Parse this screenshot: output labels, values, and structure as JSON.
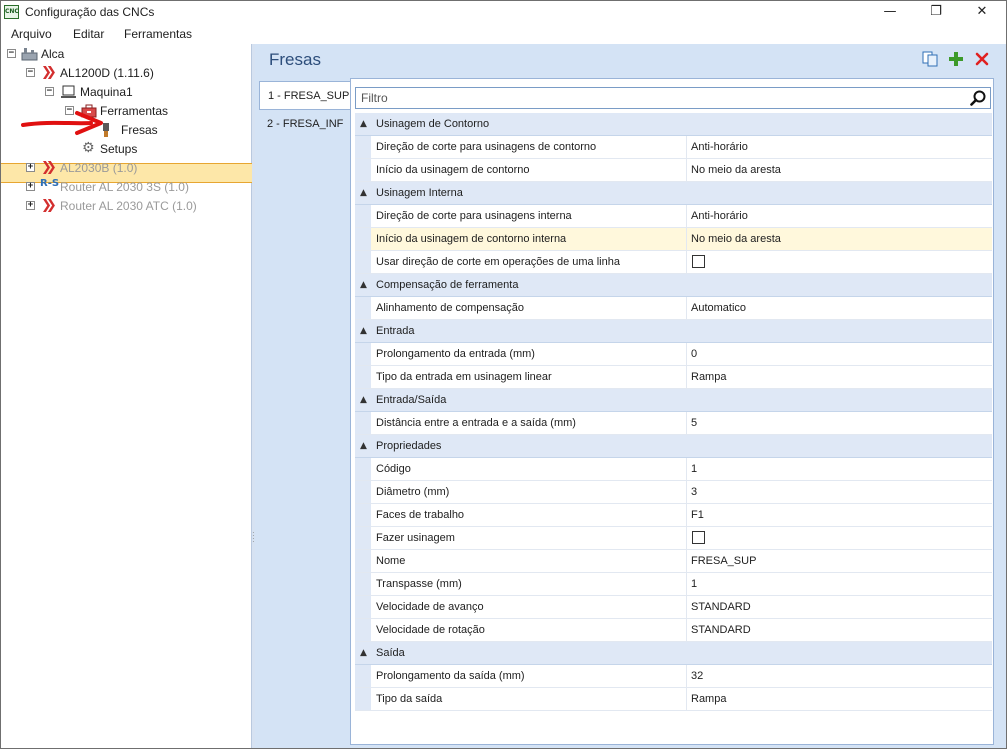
{
  "window": {
    "title": "Configuração das CNCs",
    "app_icon_text": "CNC"
  },
  "menu": [
    "Arquivo",
    "Editar",
    "Ferramentas"
  ],
  "tree": {
    "root": "Alca",
    "machine1": "AL1200D (1.11.6)",
    "maquina": "Maquina1",
    "ferramentas": "Ferramentas",
    "fresas": "Fresas",
    "setups": "Setups",
    "machine2": "AL2030B (1.0)",
    "machine3": "Router AL 2030 3S (1.0)",
    "machine3_badge": "R-S",
    "machine4": "Router AL 2030 ATC (1.0)"
  },
  "panel": {
    "title": "Fresas",
    "tabs": [
      "1 - FRESA_SUP",
      "2 - FRESA_INF"
    ],
    "active_tab": 0,
    "filter_placeholder": "Filtro"
  },
  "properties": [
    {
      "category": "Usinagem de Contorno",
      "items": [
        {
          "name": "Direção de corte para usinagens de contorno",
          "value": "Anti-horário"
        },
        {
          "name": "Início da usinagem de contorno",
          "value": "No meio da aresta"
        }
      ]
    },
    {
      "category": "Usinagem Interna",
      "items": [
        {
          "name": "Direção de corte para usinagens interna",
          "value": "Anti-horário"
        },
        {
          "name": "Início da usinagem de contorno interna",
          "value": "No meio da aresta",
          "highlight": true
        },
        {
          "name": "Usar direção de corte em operações de uma linha",
          "checkbox": false
        }
      ]
    },
    {
      "category": "Compensação de ferramenta",
      "items": [
        {
          "name": "Alinhamento de compensação",
          "value": "Automatico"
        }
      ]
    },
    {
      "category": "Entrada",
      "items": [
        {
          "name": "Prolongamento da entrada (mm)",
          "value": "0"
        },
        {
          "name": "Tipo da entrada em usinagem linear",
          "value": "Rampa"
        }
      ]
    },
    {
      "category": "Entrada/Saída",
      "items": [
        {
          "name": "Distância entre a entrada e a saída (mm)",
          "value": "5"
        }
      ]
    },
    {
      "category": "Propriedades",
      "items": [
        {
          "name": "Código",
          "value": "1"
        },
        {
          "name": "Diâmetro (mm)",
          "value": "3"
        },
        {
          "name": "Faces de trabalho",
          "value": "F1"
        },
        {
          "name": "Fazer usinagem",
          "checkbox": false
        },
        {
          "name": "Nome",
          "value": "FRESA_SUP"
        },
        {
          "name": "Transpasse (mm)",
          "value": "1"
        },
        {
          "name": "Velocidade de avanço",
          "value": "STANDARD"
        },
        {
          "name": "Velocidade de rotação",
          "value": "STANDARD"
        }
      ]
    },
    {
      "category": "Saída",
      "items": [
        {
          "name": "Prolongamento da saída (mm)",
          "value": "32"
        },
        {
          "name": "Tipo da saída",
          "value": "Rampa"
        }
      ]
    }
  ],
  "colors": {
    "accent": "#2d4e7b",
    "selection": "#fde7a8",
    "panel_bg": "#d4e3f5",
    "category_bg": "#dfe8f6",
    "arrow": "#e01010"
  }
}
